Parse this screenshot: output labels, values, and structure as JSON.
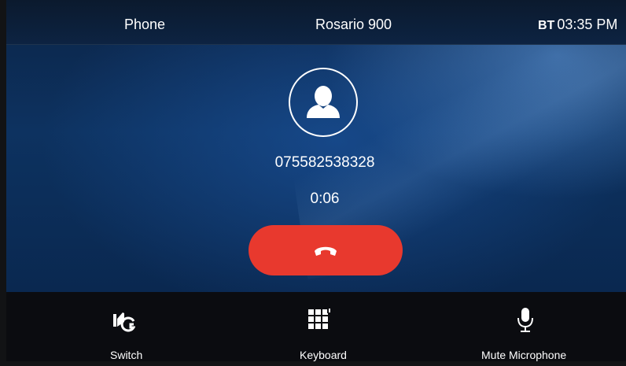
{
  "status_bar": {
    "app_name": "Phone",
    "title": "Rosario 900",
    "bt_label": "BT",
    "time": "03:35",
    "ampm": "PM"
  },
  "call": {
    "phone_number": "075582538328",
    "duration": "0:06",
    "contact_icon": "person-icon",
    "end_call_icon": "phone-hangup-icon"
  },
  "bottom_bar": {
    "items": [
      {
        "label": "Switch",
        "icon": "switch-audio-icon"
      },
      {
        "label": "Keyboard",
        "icon": "keypad-icon"
      },
      {
        "label": "Mute Microphone",
        "icon": "microphone-icon"
      }
    ]
  },
  "colors": {
    "end_call": "#e8392e",
    "background_top": "#0c2548",
    "background_mid": "#0d3260",
    "bottom_bar": "#0b0c10",
    "text": "#ffffff"
  }
}
